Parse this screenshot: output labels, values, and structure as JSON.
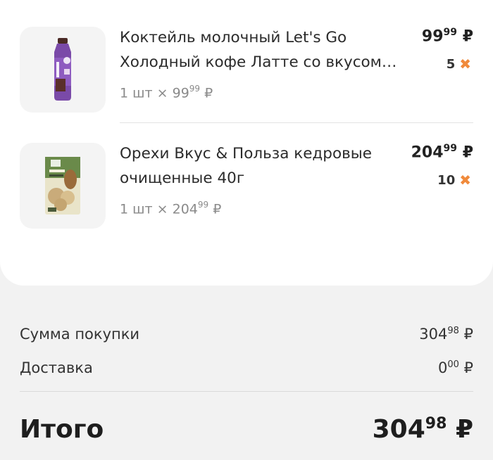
{
  "items": [
    {
      "name": "Коктейль молочный Let's Go Холодный кофе Латте со вкусом…",
      "qty_prefix": "1 шт",
      "times": "×",
      "unit_price_main": "99",
      "unit_price_cents": "99",
      "price_main": "99",
      "price_cents": "99",
      "bonus": "5",
      "currency": "₽",
      "image": "coffee-latte-bottle"
    },
    {
      "name": "Орехи Вкус & Польза кедровые очищенные 40г",
      "qty_prefix": "1 шт",
      "times": "×",
      "unit_price_main": "204",
      "unit_price_cents": "99",
      "price_main": "204",
      "price_cents": "99",
      "bonus": "10",
      "currency": "₽",
      "image": "pine-nuts-package"
    }
  ],
  "summary": {
    "purchase_label": "Сумма покупки",
    "purchase_main": "304",
    "purchase_cents": "98",
    "delivery_label": "Доставка",
    "delivery_main": "0",
    "delivery_cents": "00",
    "total_label": "Итого",
    "total_main": "304",
    "total_cents": "98",
    "currency": "₽"
  },
  "colors": {
    "accent_bonus": "#f08a3c",
    "background": "#f2f2f2",
    "card": "#ffffff"
  }
}
